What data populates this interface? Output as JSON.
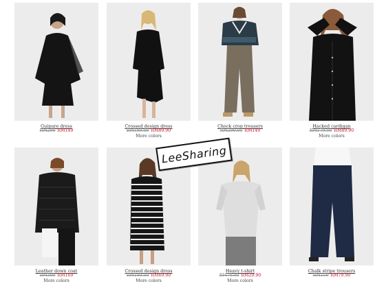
{
  "products": [
    {
      "name": "Guipure dress",
      "old_price": "RM299",
      "price": "RM149",
      "more": ""
    },
    {
      "name": "Crossed design dress",
      "old_price": "RM189.00",
      "price": "RM89.90",
      "more": "More colors"
    },
    {
      "name": "Check crop trousers",
      "old_price": "RM299.00",
      "price": "RM149",
      "more": ""
    },
    {
      "name": "Hacked cardigan",
      "old_price": "RM179.00",
      "price": "RM89.90",
      "more": "More colors"
    },
    {
      "name": "Leather down coat",
      "old_price": "RM399",
      "price": "RM169",
      "more": "More colors"
    },
    {
      "name": "Crossed design dress",
      "old_price": "RM189.00",
      "price": "RM69.90",
      "more": "More colors"
    },
    {
      "name": "Heavy t-shirt",
      "old_price": "RM79.90",
      "price": "RM29.90",
      "more": "More colors"
    },
    {
      "name": "Chalk stripe trousers",
      "old_price": "RM159",
      "price": "RM79.90",
      "more": ""
    }
  ],
  "watermark": "LeeSharing",
  "colors": {
    "sale": "#c8102e",
    "photo_bg": "#ececec"
  }
}
